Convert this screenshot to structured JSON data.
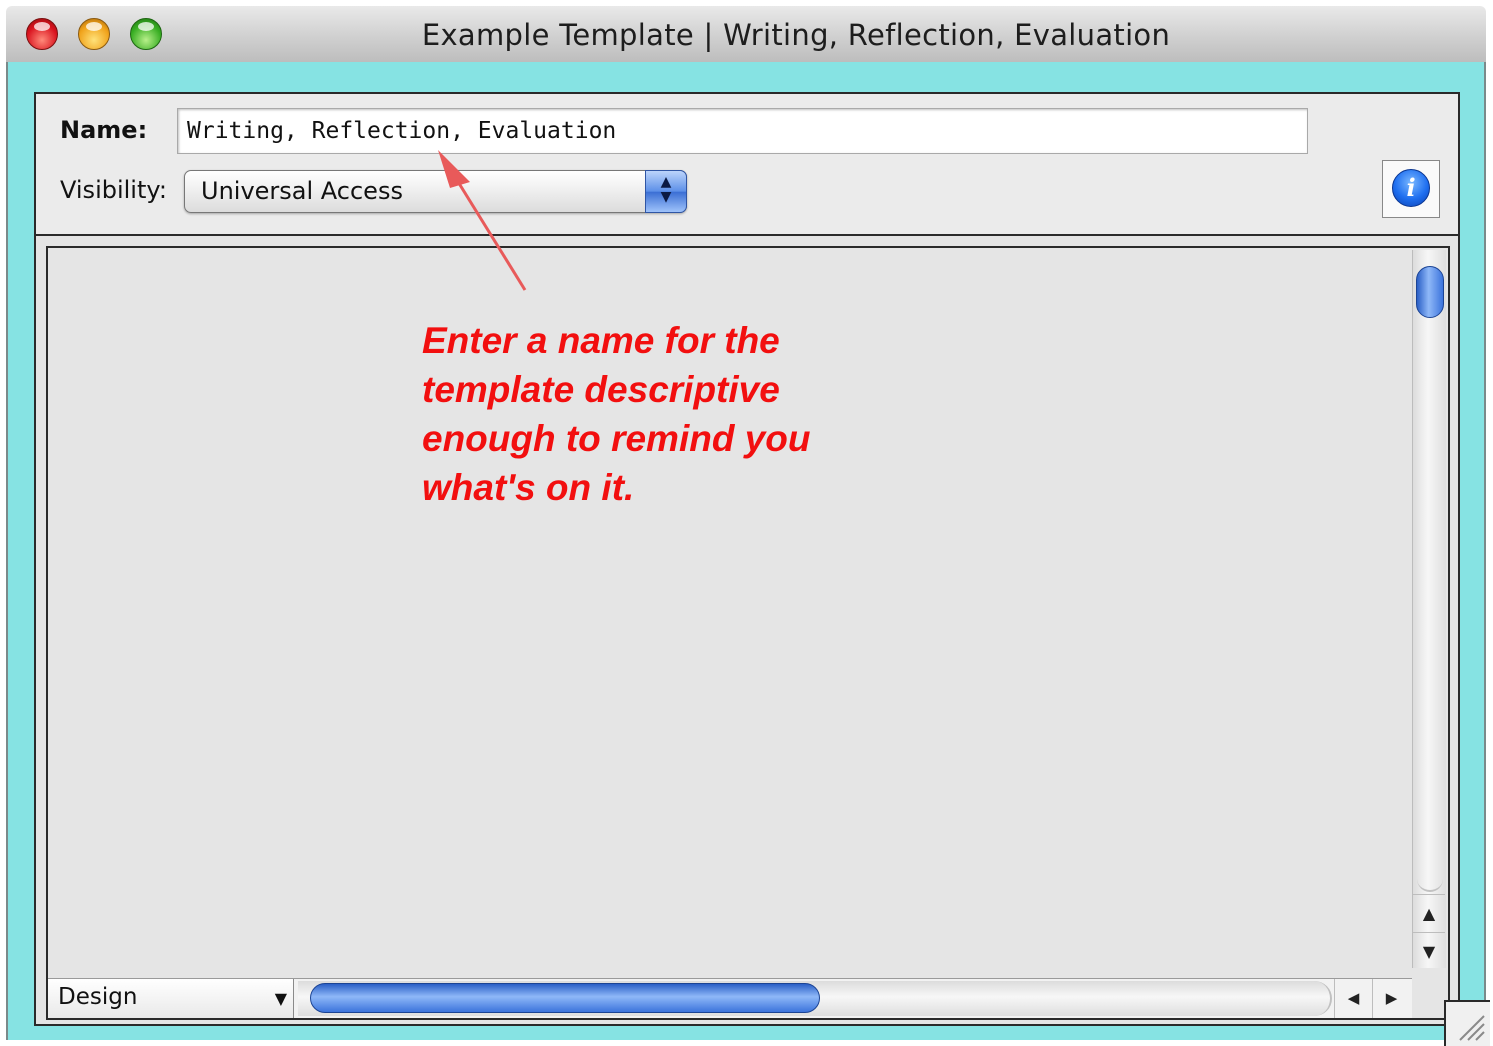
{
  "window": {
    "title": "Example Template | Writing, Reflection, Evaluation"
  },
  "form": {
    "name_label": "Name:",
    "name_value": "Writing, Reflection, Evaluation",
    "visibility_label": "Visibility:",
    "visibility_value": "Universal Access"
  },
  "annotation": {
    "text": "Enter a name for the\ntemplate descriptive\nenough to remind you\nwhat's on it.",
    "color": "#f20f0f"
  },
  "bottom_bar": {
    "mode_value": "Design"
  },
  "icons": {
    "info": "info-icon",
    "scroll_up": "arrow-up-icon",
    "scroll_down": "arrow-down-icon",
    "scroll_left": "arrow-left-icon",
    "scroll_right": "arrow-right-icon"
  },
  "colors": {
    "frame": "#86e3e3",
    "scroll_thumb": "#3c74dc"
  }
}
